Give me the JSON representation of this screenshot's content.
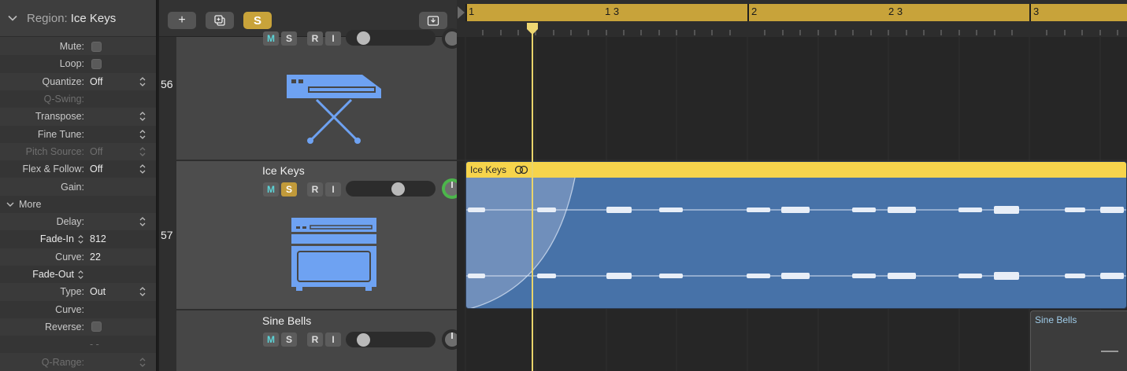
{
  "inspector": {
    "header_label": "Region:",
    "header_value": "Ice Keys",
    "rows": {
      "mute": "Mute:",
      "loop": "Loop:",
      "quantize": "Quantize:",
      "quantize_value": "Off",
      "qswing": "Q-Swing:",
      "transpose": "Transpose:",
      "finetune": "Fine Tune:",
      "pitchsource": "Pitch Source:",
      "pitchsource_value": "Off",
      "flexfollow": "Flex & Follow:",
      "flexfollow_value": "Off",
      "gain": "Gain:",
      "more": "More",
      "delay": "Delay:",
      "fadein": "Fade-In",
      "fadein_value": "812",
      "curve": "Curve:",
      "curve_value": "22",
      "fadeout": "Fade-Out",
      "type": "Type:",
      "type_value": "Out",
      "curve2": "Curve:",
      "reverse": "Reverse:",
      "dashes": "- -",
      "qrange": "Q-Range:"
    }
  },
  "toolbar": {
    "add": "+",
    "solo": "S"
  },
  "tracks": [
    {
      "number": "56",
      "name": "",
      "m": "M",
      "s": "S",
      "r": "R",
      "i": "I"
    },
    {
      "number": "57",
      "name": "Ice Keys",
      "m": "M",
      "s": "S",
      "r": "R",
      "i": "I"
    },
    {
      "number": "",
      "name": "Sine Bells",
      "m": "M",
      "s": "S",
      "r": "R",
      "i": "I"
    }
  ],
  "ruler": {
    "labels": [
      "1",
      "1 3",
      "2",
      "2 3",
      "3"
    ]
  },
  "regions": {
    "ice_keys": "Ice Keys",
    "sine_bells": "Sine Bells"
  },
  "colors": {
    "accent_gold": "#c8a33a",
    "region_blue": "#4772a8",
    "region_header": "#f6d44c",
    "track_icon_blue": "#6ea2f2"
  }
}
